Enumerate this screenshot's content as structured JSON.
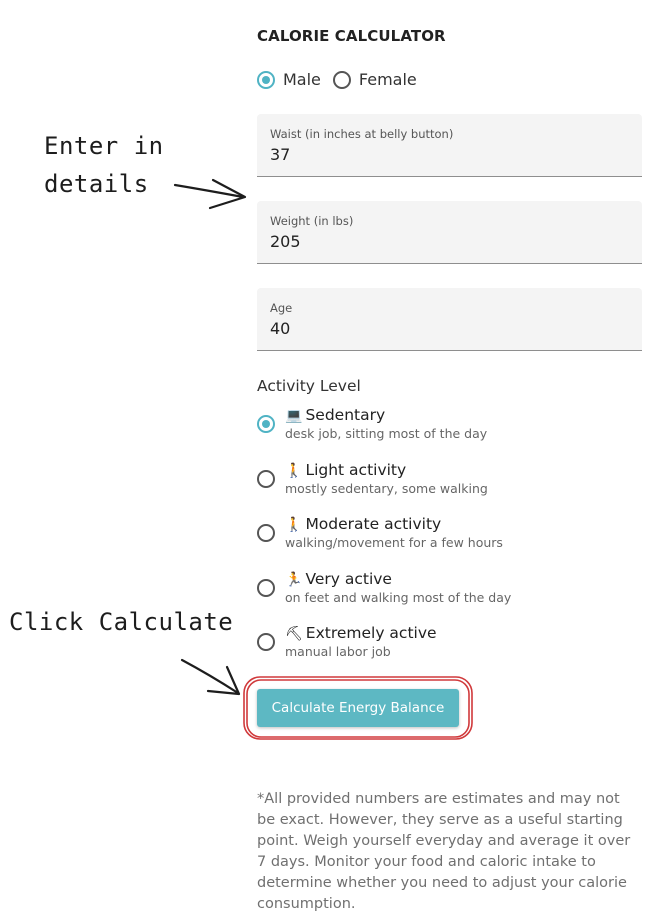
{
  "calculator": {
    "title": "CALORIE CALCULATOR",
    "gender": {
      "options": [
        "Male",
        "Female"
      ],
      "selected": "Male"
    },
    "fields": [
      {
        "label": "Waist (in inches at belly button)",
        "value": "37"
      },
      {
        "label": "Weight (in lbs)",
        "value": "205"
      },
      {
        "label": "Age",
        "value": "40"
      }
    ],
    "activity": {
      "title": "Activity Level",
      "selected": "Sedentary",
      "options": [
        {
          "icon": "💻",
          "icon_name": "laptop-icon",
          "name": "Sedentary",
          "desc": "desk job, sitting most of the day"
        },
        {
          "icon": "🚶",
          "icon_name": "walking-person-icon",
          "name": "Light activity",
          "desc": "mostly sedentary, some walking"
        },
        {
          "icon": "🚶",
          "icon_name": "walking-person-icon",
          "name": "Moderate activity",
          "desc": "walking/movement for a few hours"
        },
        {
          "icon": "🏃",
          "icon_name": "running-person-icon",
          "name": "Very active",
          "desc": "on feet and walking most of the day"
        },
        {
          "icon": "⛏",
          "icon_name": "shovel-icon",
          "name": "Extremely active",
          "desc": "manual labor job"
        }
      ]
    },
    "button_label": "Calculate Energy Balance",
    "disclaimer": "*All provided numbers are estimates and may not be exact. However, they serve as a useful starting point. Weigh yourself everyday and average it over 7 days. Monitor your food and caloric intake to determine whether you need to adjust your calorie consumption."
  },
  "annotations": {
    "enter_line1": "Enter in",
    "enter_line2": "details",
    "click": "Click Calculate"
  },
  "colors": {
    "accent": "#5db8c3",
    "radio_checked": "#4fb3c4",
    "highlight": "#d0393b"
  }
}
